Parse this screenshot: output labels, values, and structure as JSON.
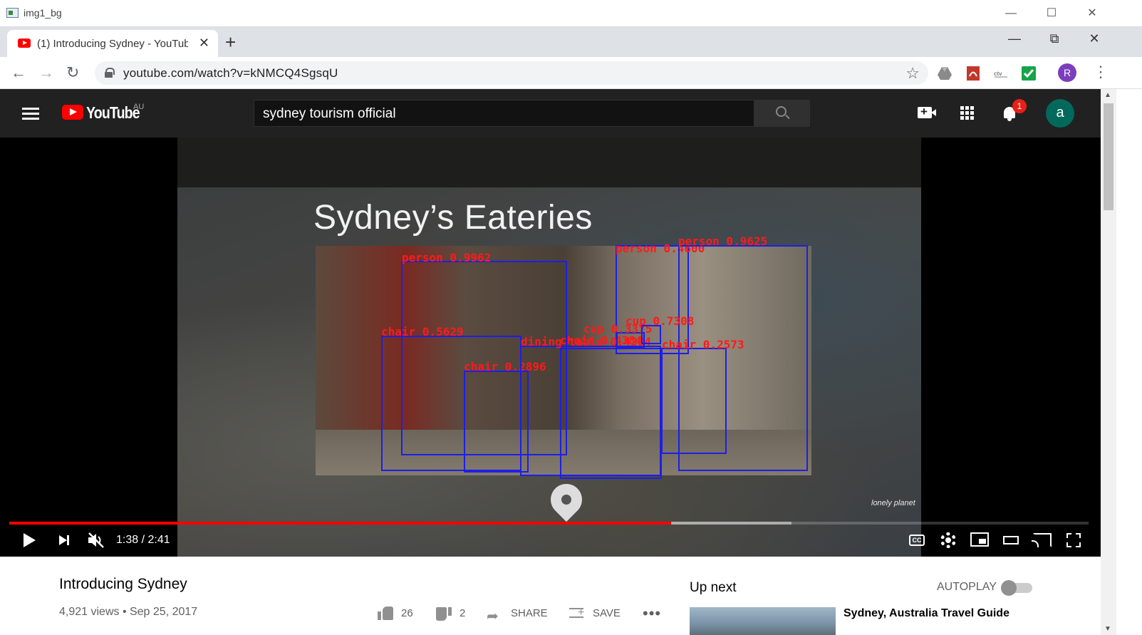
{
  "window": {
    "title": "img1_bg",
    "controls": [
      "—",
      "☐",
      "✕"
    ]
  },
  "browser": {
    "tab_title": "(1) Introducing Sydney - YouTube",
    "tab_close": "✕",
    "new_tab": "+",
    "strip_controls": [
      "—",
      "⧉",
      "✕"
    ],
    "url": "youtube.com/watch?v=kNMCQ4SgsqU",
    "nav": {
      "back": "←",
      "forward": "→",
      "reload": "↻"
    },
    "star": "☆",
    "profile_initial": "R",
    "menu": "⋮",
    "extensions": [
      "drive-icon",
      "pdf-icon",
      "ctv-icon",
      "check-icon"
    ],
    "extension_colors": [
      "#8a8a8a",
      "#c0392b",
      "#7f7f7f",
      "#16a34a"
    ]
  },
  "youtube": {
    "logo_text": "YouTube",
    "country": "AU",
    "search_query": "sydney tourism official",
    "notification_count": "1",
    "account_initial": "a"
  },
  "player": {
    "scene_title": "Sydney’s Eateries",
    "watermark": "lonely planet",
    "current_time": "1:38",
    "duration": "2:41",
    "time_display": "1:38 / 2:41",
    "progress_fraction": 0.613,
    "buffer_fraction": 0.725,
    "cc_label": "CC",
    "detections": [
      {
        "label": "person 0.9962"
      },
      {
        "label": "person 0.4600"
      },
      {
        "label": "person 0.9625"
      },
      {
        "label": "chair 0.5629"
      },
      {
        "label": "chair 0.2896"
      },
      {
        "label": "chair 0.2573"
      },
      {
        "label": "dining table 0.4384"
      },
      {
        "label": "chair 0.4384"
      },
      {
        "label": "cup 0.3375"
      },
      {
        "label": "cup 0.7308"
      }
    ]
  },
  "video": {
    "title": "Introducing Sydney",
    "views": "4,921 views",
    "date": "Sep 25, 2017",
    "meta": "4,921 views • Sep 25, 2017",
    "likes": "26",
    "dislikes": "2",
    "share_label": "SHARE",
    "save_label": "SAVE",
    "more": "•••"
  },
  "sidebar": {
    "up_next": "Up next",
    "autoplay_label": "AUTOPLAY",
    "autoplay_on": false,
    "first_recommendation": "Sydney, Australia Travel Guide"
  },
  "colors": {
    "masthead": "#212121",
    "progress": "#ff0000",
    "detection_box": "#1e1ee6",
    "detection_label": "#ff1a1a"
  }
}
